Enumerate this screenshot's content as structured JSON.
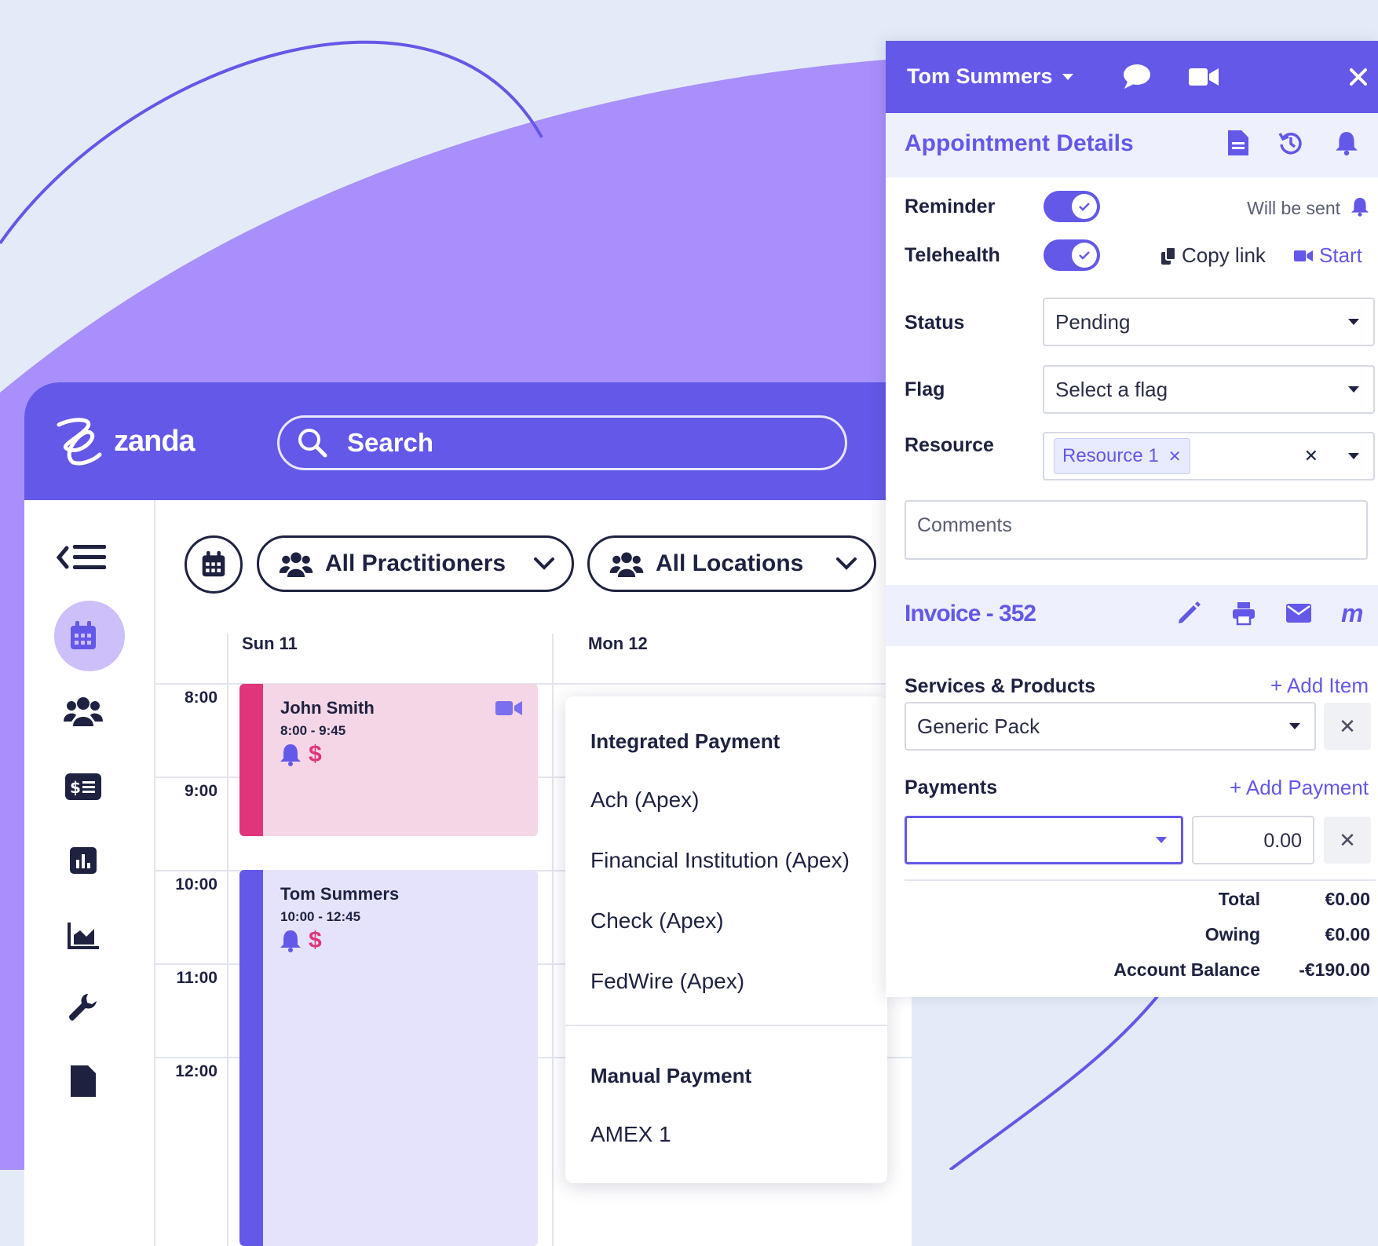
{
  "colors": {
    "brand": "#6358e8",
    "brand_light": "#a88ffc",
    "pink": "#e0357a",
    "bg": "#e4ebf8"
  },
  "app": {
    "logo_text": "zanda",
    "search_placeholder": "Search"
  },
  "filters": {
    "practitioners": "All Practitioners",
    "locations": "All Locations"
  },
  "sidebar_icons": [
    "menu-collapse-icon",
    "calendar-icon",
    "clients-icon",
    "billing-icon",
    "reports-icon",
    "analytics-icon",
    "settings-wrench-icon",
    "documents-icon"
  ],
  "calendar": {
    "days": [
      "Sun 11",
      "Mon 12"
    ],
    "times": [
      "8:00",
      "9:00",
      "10:00",
      "11:00",
      "12:00"
    ],
    "appointments": [
      {
        "name": "John Smith",
        "time": "8:00 - 9:45"
      },
      {
        "name": "Tom Summers",
        "time": "10:00 - 12:45"
      }
    ]
  },
  "payment_menu": {
    "integrated_header": "Integrated Payment",
    "integrated_items": [
      "Ach (Apex)",
      "Financial Institution (Apex)",
      "Check (Apex)",
      "FedWire (Apex)"
    ],
    "manual_header": "Manual Payment",
    "manual_items": [
      "AMEX 1"
    ]
  },
  "panel": {
    "patient": "Tom Summers",
    "appointment_title": "Appointment Details",
    "reminder_label": "Reminder",
    "reminder_status": "Will be sent",
    "telehealth_label": "Telehealth",
    "copy_link": "Copy link",
    "start": "Start",
    "status_label": "Status",
    "status_value": "Pending",
    "flag_label": "Flag",
    "flag_placeholder": "Select a flag",
    "resource_label": "Resource",
    "resource_tag": "Resource 1",
    "comments_placeholder": "Comments",
    "invoice_title": "Invoice - 352",
    "services_label": "Services & Products",
    "add_item": "+ Add Item",
    "service_value": "Generic Pack",
    "payments_label": "Payments",
    "add_payment": "+ Add Payment",
    "payment_amount": "0.00",
    "total_label": "Total",
    "total_value": "€0.00",
    "owing_label": "Owing",
    "owing_value": "€0.00",
    "balance_label": "Account Balance",
    "balance_value": "-€190.00"
  }
}
